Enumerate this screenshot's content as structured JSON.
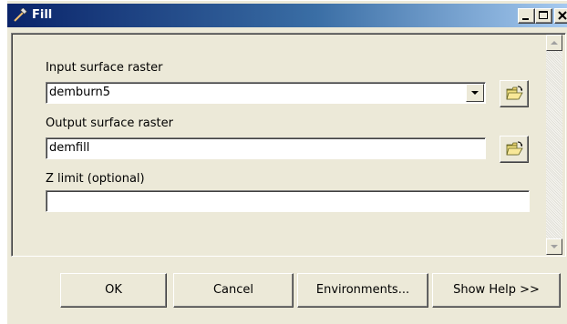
{
  "window": {
    "title": "Fill",
    "controls": {
      "minimize": "_",
      "maximize": "□",
      "close": "×"
    }
  },
  "form": {
    "input_raster": {
      "label": "Input surface raster",
      "value": "demburn5"
    },
    "output_raster": {
      "label": "Output surface raster",
      "value": "demfill"
    },
    "z_limit": {
      "label": "Z limit (optional)",
      "value": ""
    }
  },
  "buttons": {
    "ok": "OK",
    "cancel": "Cancel",
    "environments": "Environments...",
    "show_help": "Show Help >>"
  },
  "icons": {
    "title": "hammer-icon",
    "browse": "open-folder-icon",
    "dropdown": "chevron-down-icon"
  },
  "colors": {
    "titlebar_start": "#0a246a",
    "titlebar_end": "#a6caf0",
    "face": "#ece9d8"
  }
}
